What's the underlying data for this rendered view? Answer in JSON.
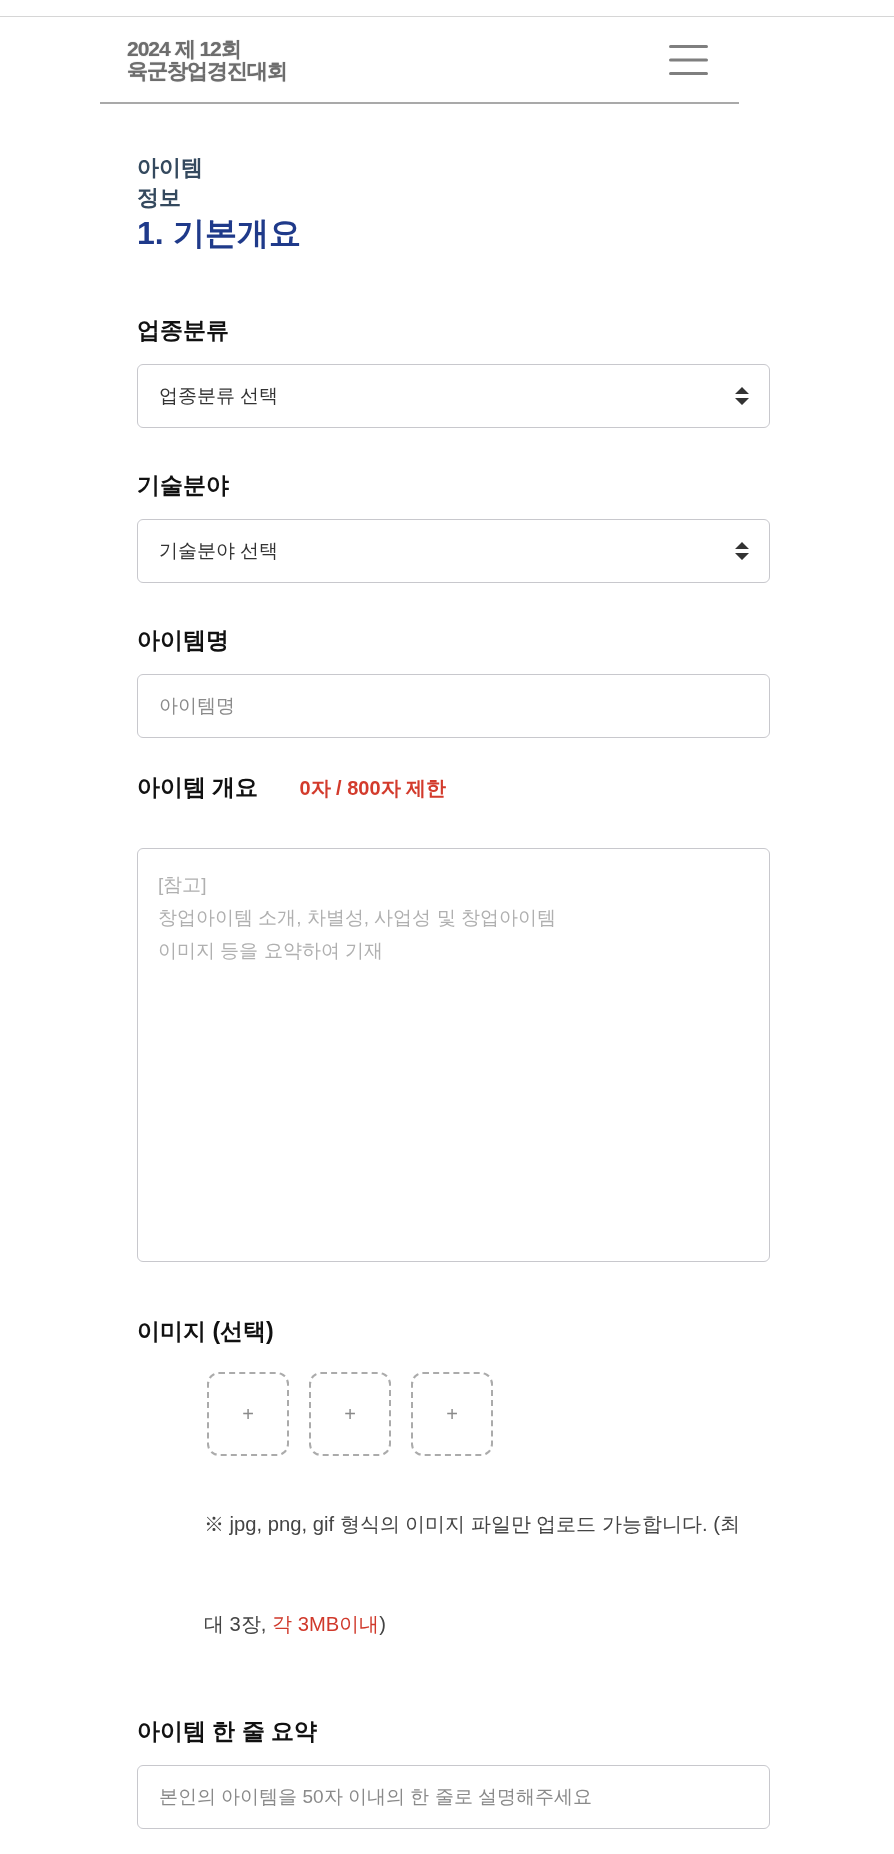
{
  "header": {
    "logo": "2024 제 12회\n육군창업경진대회"
  },
  "section": {
    "title": "아이템 정보",
    "heading": "1. 기본개요"
  },
  "fields": [
    {
      "kind": "select",
      "label": "업종분류",
      "value": "업종분류 선택"
    },
    {
      "kind": "select",
      "label": "기술분야",
      "value": "기술분야 선택"
    },
    {
      "kind": "input",
      "label": "아이템명",
      "placeholder": "아이템명"
    },
    {
      "kind": "textarea",
      "label": "아이템 개요",
      "counter": "0자 / 800자 제한",
      "placeholder": "[참고]\n창업아이템 소개, 차별성, 사업성 및 창업아이템\n이미지 등을 요약하여 기재"
    },
    {
      "kind": "images",
      "label": "이미지 (선택)",
      "slots": [
        "+",
        "+",
        "+"
      ],
      "note": {
        "text": "※ jpg, png, gif 형식의 이미지 파일만 업로드 가능합니다. (최대 3장, ",
        "highlight": "각 3MB이내",
        "end": ")"
      }
    },
    {
      "kind": "input",
      "label": "아이템 한 줄 요약",
      "placeholder": "본인의 아이템을 50자 이내의 한 줄로 설명해주세요"
    }
  ]
}
